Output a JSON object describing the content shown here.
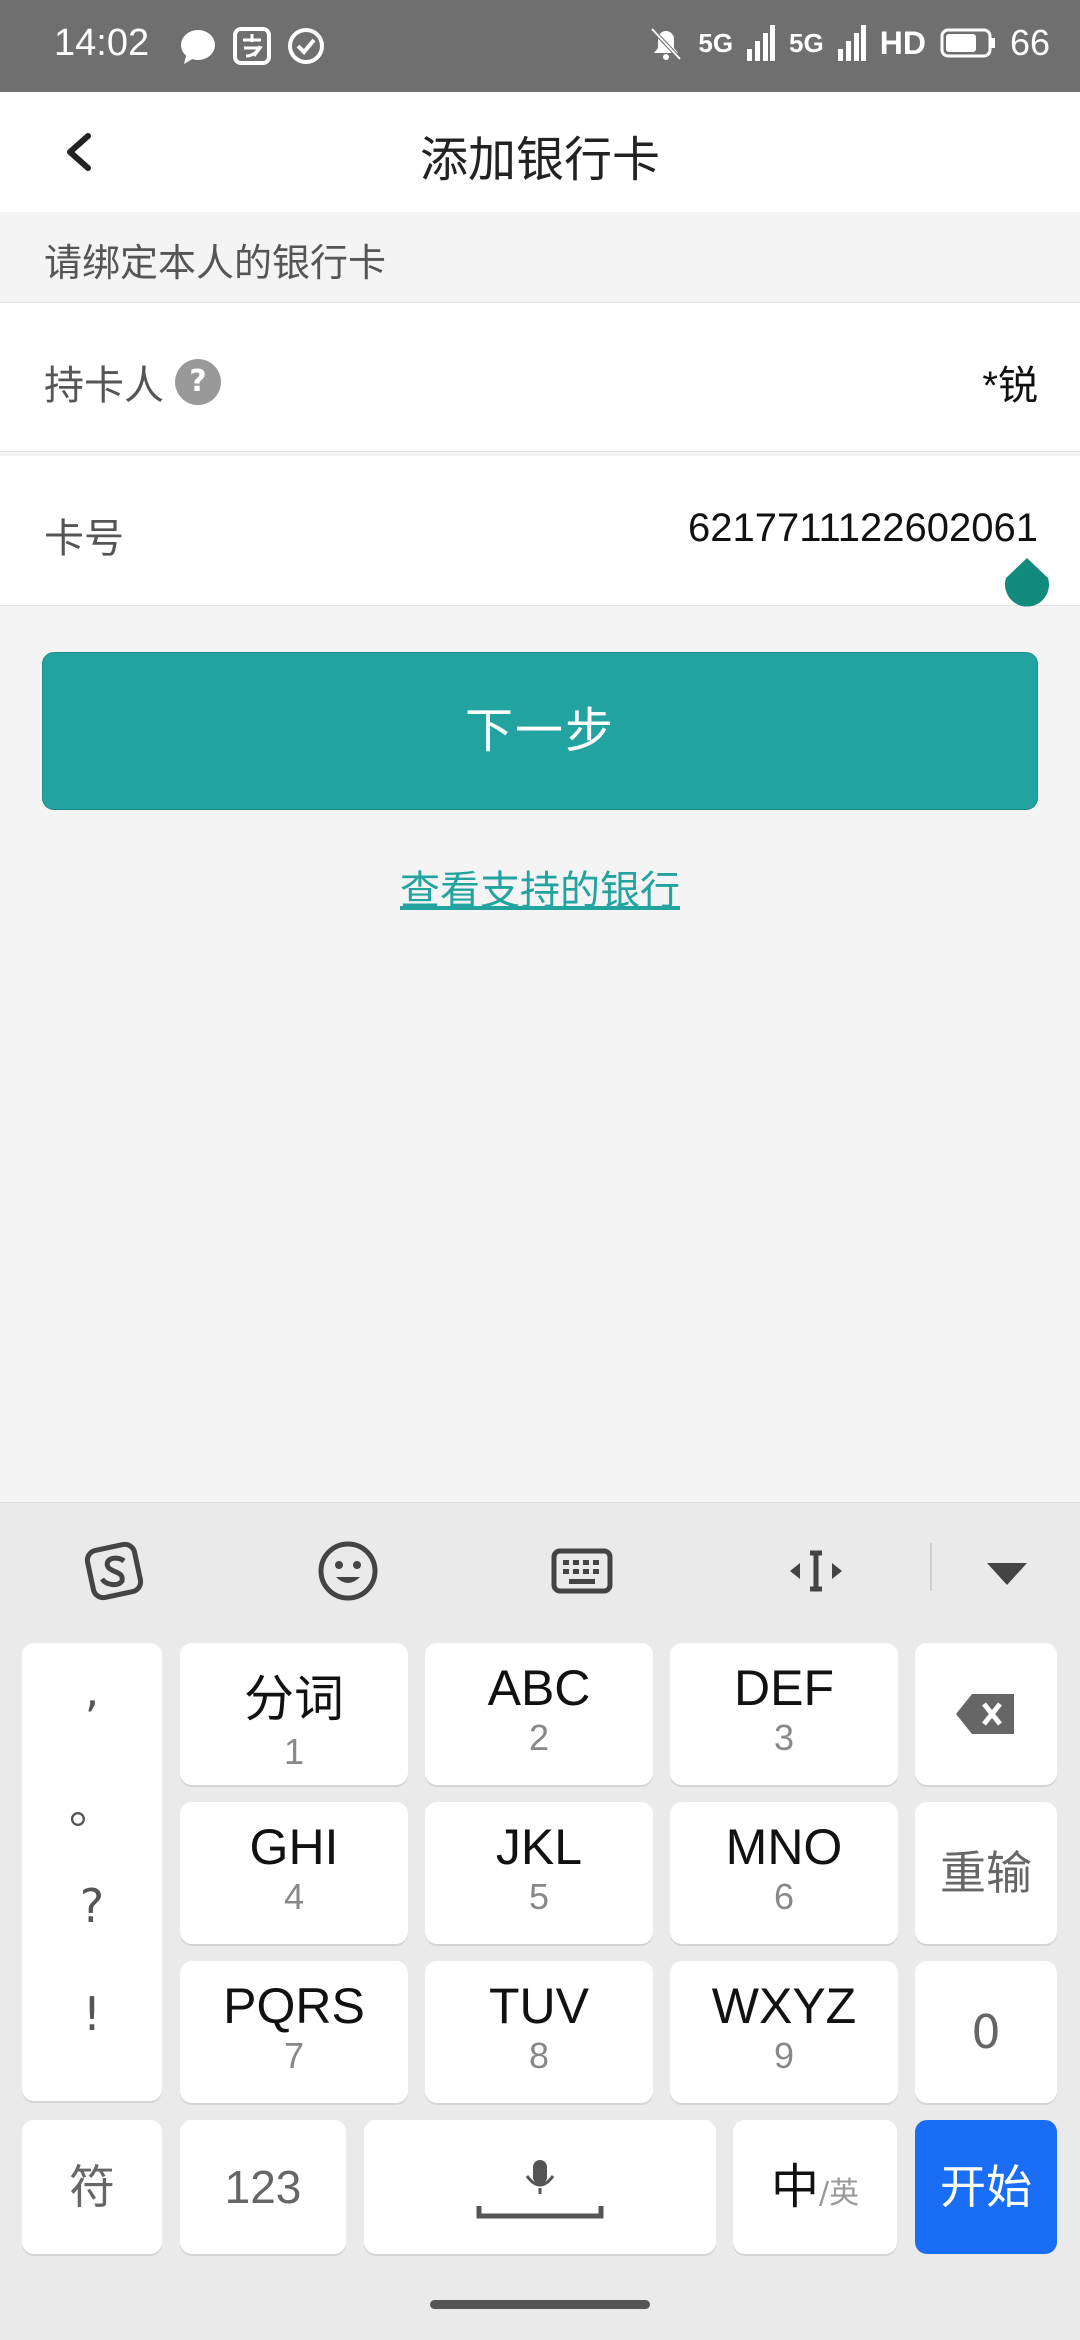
{
  "status_bar": {
    "time": "14:02",
    "net1": "5G",
    "net2": "5G",
    "hd": "HD",
    "battery": "66"
  },
  "nav": {
    "title": "添加银行卡"
  },
  "form": {
    "hint": "请绑定本人的银行卡",
    "holder_label": "持卡人",
    "help_glyph": "?",
    "holder_value": "*锐",
    "card_label": "卡号",
    "card_value": "6217711122602061",
    "next_button": "下一步",
    "supported_banks_link": "查看支持的银行"
  },
  "keyboard": {
    "punctuation": [
      ",",
      "。",
      "?",
      "!"
    ],
    "keys": [
      {
        "main": "分词",
        "sub": "1"
      },
      {
        "main": "ABC",
        "sub": "2"
      },
      {
        "main": "DEF",
        "sub": "3"
      },
      {
        "main": "GHI",
        "sub": "4"
      },
      {
        "main": "JKL",
        "sub": "5"
      },
      {
        "main": "MNO",
        "sub": "6"
      },
      {
        "main": "PQRS",
        "sub": "7"
      },
      {
        "main": "TUV",
        "sub": "8"
      },
      {
        "main": "WXYZ",
        "sub": "9"
      }
    ],
    "reinput": "重输",
    "zero": "0",
    "symbols": "符",
    "numbers": "123",
    "lang_main": "中",
    "lang_sep": "/",
    "lang_alt": "英",
    "enter": "开始"
  },
  "colors": {
    "accent": "#22a39f",
    "enter_key": "#1a6ef5",
    "status_bar": "#6f6f6f"
  }
}
